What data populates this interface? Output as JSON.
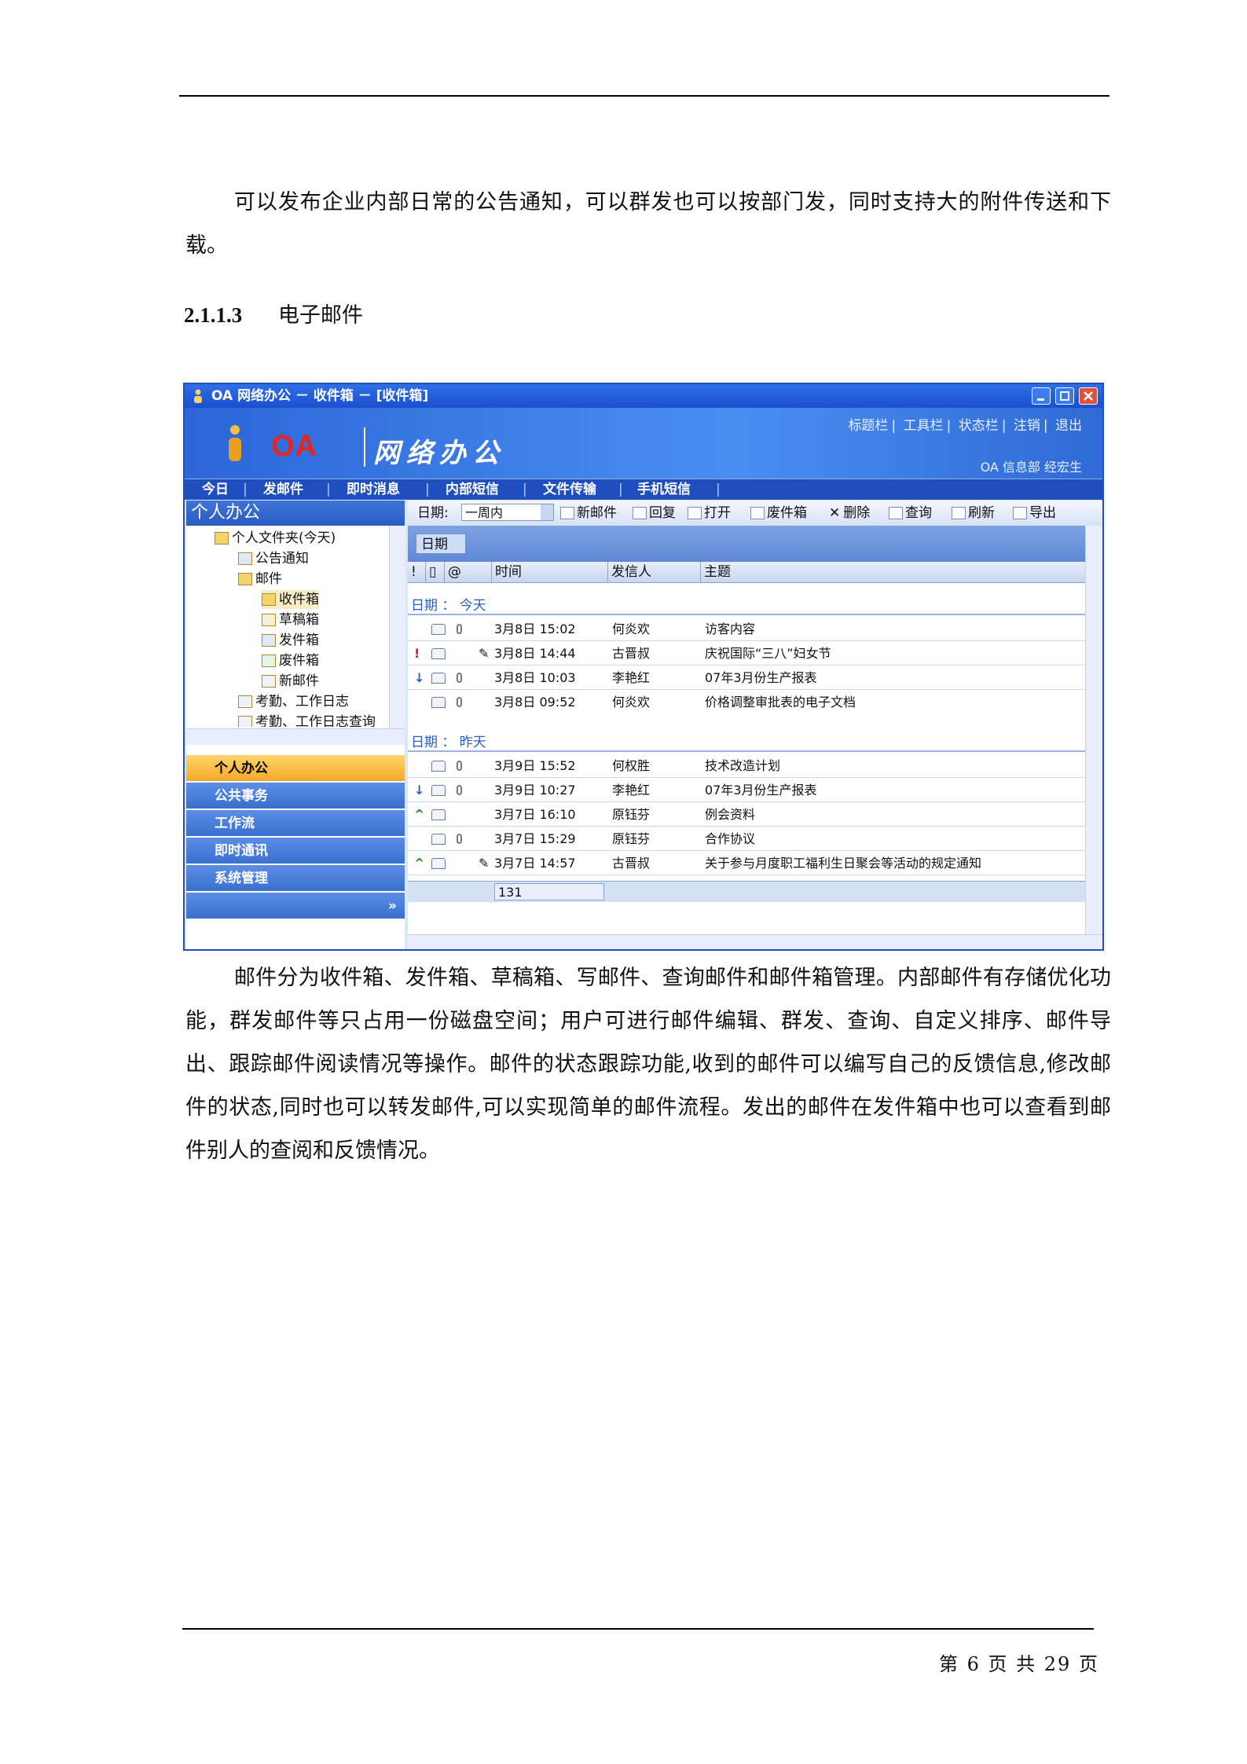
{
  "document": {
    "paragraph_1": "可以发布企业内部日常的公告通知，可以群发也可以按部门发，同时支持大的附件传送和下载。",
    "section_number": "2.1.1.3",
    "section_title": "电子邮件",
    "paragraph_2": "邮件分为收件箱、发件箱、草稿箱、写邮件、查询邮件和邮件箱管理。内部邮件有存储优化功能，群发邮件等只占用一份磁盘空间；用户可进行邮件编辑、群发、查询、自定义排序、邮件导出、跟踪邮件阅读情况等操作。邮件的状态跟踪功能,收到的邮件可以编写自己的反馈信息,修改邮件的状态,同时也可以转发邮件,可以实现简单的邮件流程。发出的邮件在发件箱中也可以查看到邮件别人的查阅和反馈情况。",
    "footer": "第 6 页 共 29 页"
  },
  "app": {
    "window_title": "OA 网络办公 － 收件箱 － [收件箱]",
    "logo_text": "OA",
    "logo_name": "网络办公",
    "bar_links": [
      "标题栏",
      "工具栏",
      "状态栏",
      "注销",
      "退出"
    ],
    "user_info": "OA  信息部 经宏生",
    "nav": [
      "今日",
      "发邮件",
      "即时消息",
      "内部短信",
      "文件传输",
      "手机短信"
    ],
    "left_title": "个人办公",
    "tree": [
      "个人文件夹(今天)",
      "公告通知",
      "邮件",
      "收件箱",
      "草稿箱",
      "发件箱",
      "废件箱",
      "新邮件",
      "考勤、工作日志",
      "考勤、工作日志查询"
    ],
    "modules": [
      "个人办公",
      "公共事务",
      "工作流",
      "即时通讯",
      "系统管理"
    ],
    "toolbar": {
      "date_label": "日期:",
      "date_value": "一周内",
      "buttons": [
        "新邮件",
        "回复",
        "打开",
        "废件箱",
        "删除",
        "查询",
        "刷新",
        "导出"
      ]
    },
    "group_chip": "日期",
    "columns": [
      "!",
      "时间",
      "发信人",
      "主题"
    ],
    "groups": [
      {
        "label": "日期 ： 今天",
        "rows": [
          {
            "time": "3月8日 15:02",
            "sender": "何炎欢",
            "subject": "访客内容",
            "flag": "",
            "attach": true,
            "edit": false
          },
          {
            "time": "3月8日 14:44",
            "sender": "古晋叔",
            "subject": "庆祝国际“三八”妇女节",
            "flag": "!",
            "attach": false,
            "edit": true
          },
          {
            "time": "3月8日 10:03",
            "sender": "李艳红",
            "subject": "07年3月份生产报表",
            "flag": "↓",
            "attach": true,
            "edit": false
          },
          {
            "time": "3月8日 09:52",
            "sender": "何炎欢",
            "subject": "价格调整审批表的电子文档",
            "flag": "",
            "attach": true,
            "edit": false
          }
        ]
      },
      {
        "label": "日期 ： 昨天",
        "rows": [
          {
            "time": "3月9日 15:52",
            "sender": "何权胜",
            "subject": "技术改造计划",
            "flag": "",
            "attach": true,
            "edit": false
          },
          {
            "time": "3月9日 10:27",
            "sender": "李艳红",
            "subject": "07年3月份生产报表",
            "flag": "↓",
            "attach": true,
            "edit": false
          },
          {
            "time": "3月7日 16:10",
            "sender": "原钰芬",
            "subject": "例会资料",
            "flag": "^",
            "attach": false,
            "edit": false
          },
          {
            "time": "3月7日 15:29",
            "sender": "原钰芬",
            "subject": "合作协议",
            "flag": "",
            "attach": true,
            "edit": false
          },
          {
            "time": "3月7日 14:57",
            "sender": "古晋叔",
            "subject": "关于参与月度职工福利生日聚会等活动的规定通知",
            "flag": "^",
            "attach": false,
            "edit": true
          }
        ]
      }
    ],
    "count": "131",
    "colors": {
      "accent": "#1f4fbf",
      "banner": "#4a8ef0",
      "active_module": "#f3a82a",
      "logo_red": "#e8251a"
    }
  }
}
